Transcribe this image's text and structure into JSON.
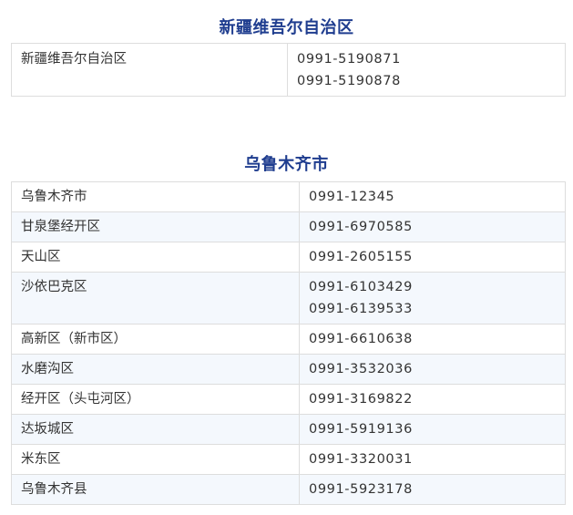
{
  "section1": {
    "title": "新疆维吾尔自治区",
    "rows": [
      {
        "name": "新疆维吾尔自治区",
        "phones": [
          "0991-5190871",
          "0991-5190878"
        ]
      }
    ]
  },
  "section2": {
    "title": "乌鲁木齐市",
    "rows": [
      {
        "name": "乌鲁木齐市",
        "phones": [
          "0991-12345"
        ]
      },
      {
        "name": "甘泉堡经开区",
        "phones": [
          "0991-6970585"
        ]
      },
      {
        "name": "天山区",
        "phones": [
          "0991-2605155"
        ]
      },
      {
        "name": "沙依巴克区",
        "phones": [
          "0991-6103429",
          "0991-6139533"
        ]
      },
      {
        "name": "高新区（新市区）",
        "phones": [
          "0991-6610638"
        ]
      },
      {
        "name": "水磨沟区",
        "phones": [
          "0991-3532036"
        ]
      },
      {
        "name": "经开区（头屯河区）",
        "phones": [
          "0991-3169822"
        ]
      },
      {
        "name": "达坂城区",
        "phones": [
          "0991-5919136"
        ]
      },
      {
        "name": "米东区",
        "phones": [
          "0991-3320031"
        ]
      },
      {
        "name": "乌鲁木齐县",
        "phones": [
          "0991-5923178"
        ]
      }
    ]
  }
}
